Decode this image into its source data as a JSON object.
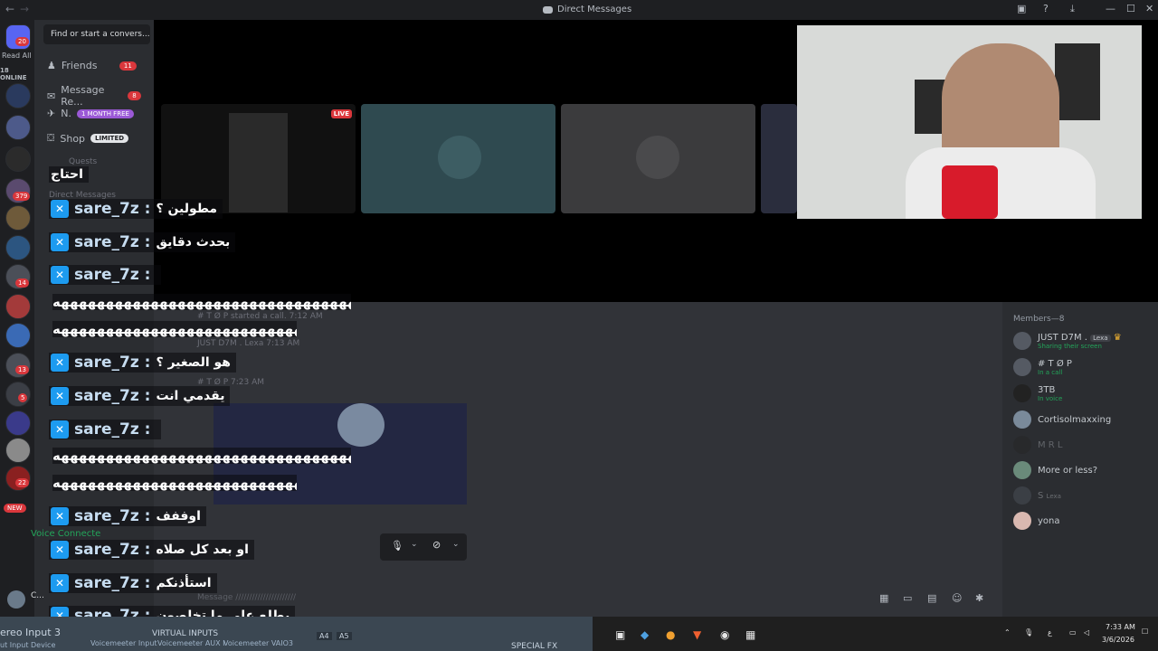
{
  "window": {
    "title": "Direct Messages"
  },
  "guilds": {
    "read_all": "Read All",
    "online": "18 ONLINE",
    "badges": [
      "20",
      "379",
      "14",
      "13",
      "5",
      "22"
    ],
    "new_label": "NEW"
  },
  "sidebar": {
    "search_placeholder": "Find or start a convers...",
    "nav": [
      {
        "label": "Friends",
        "badge": "11"
      },
      {
        "label": "Message Re...",
        "badge": "8"
      },
      {
        "label": "N.",
        "badge": "1 MONTH FREE"
      },
      {
        "label": "Shop",
        "badge": "LIMITED"
      }
    ],
    "quests": "Quests",
    "dm_header": "Direct Messages",
    "voice_connected": "Voice Connecte",
    "user_initial": "C..."
  },
  "stage": {
    "live_label": "LIVE"
  },
  "chat": {
    "user": "sare_7z :",
    "lines": [
      {
        "text": "احتاج",
        "user": false
      },
      {
        "text": "مطولين ؟",
        "user": true
      },
      {
        "text": "بحدث دقايق",
        "user": true
      },
      {
        "text": "",
        "user": true
      },
      {
        "text": "هههههههههههههههههههههههههههههههههههههههه",
        "user": false
      },
      {
        "text": "هههههههههههههههههههههههههههههههه",
        "user": false
      },
      {
        "text": "هو الصغير ؟",
        "user": true
      },
      {
        "text": "يقدمي انت",
        "user": true
      },
      {
        "text": "",
        "user": true
      },
      {
        "text": "هههههههههههههههههههههههههههههههههههههههه",
        "user": false
      },
      {
        "text": "هههههههههههههههههههههههههههههههه",
        "user": false
      },
      {
        "text": "اوففف",
        "user": true
      },
      {
        "text": "او بعد كل صلاه",
        "user": true
      },
      {
        "text": "استأذنكم",
        "user": true
      },
      {
        "text": "بطلع على ما تخلصون",
        "user": true
      }
    ],
    "bg_lines": [
      "# T Ø P started a call. 7:12 AM",
      "JUST D7M . Lexa 7:13 AM",
      "# T Ø P 7:23 AM"
    ]
  },
  "composer": {
    "placeholder": "Message //////////////////////"
  },
  "members": {
    "header": "Members—8",
    "list": [
      {
        "name": "JUST D7M .",
        "tag": "Lexa",
        "sub": "Sharing their screen"
      },
      {
        "name": "# T Ø P",
        "tag": "",
        "sub": "In a call"
      },
      {
        "name": "3TB",
        "tag": "",
        "sub": "In voice"
      },
      {
        "name": "Cortisolmaxxing",
        "tag": "",
        "sub": ""
      },
      {
        "name": "M R L",
        "tag": "",
        "sub": ""
      },
      {
        "name": "More or less?",
        "tag": "",
        "sub": ""
      },
      {
        "name": "S",
        "tag": "Lexa",
        "sub": ""
      },
      {
        "name": "yona",
        "tag": "",
        "sub": ""
      }
    ]
  },
  "taskbar": {
    "vm_title": "ereo Input 3",
    "vm_sub": "ut Input Device",
    "virtual_inputs": "VIRTUAL INPUTS",
    "vm_channels": [
      "Voicemeeter Input",
      "Voicemeeter AUX I",
      "Voicemeeter VAIO3"
    ],
    "buttons": [
      "A4",
      "A5"
    ],
    "special_fx": "SPECIAL FX",
    "time": "7:33 AM",
    "date": "3/6/2026",
    "lang": "ع"
  }
}
